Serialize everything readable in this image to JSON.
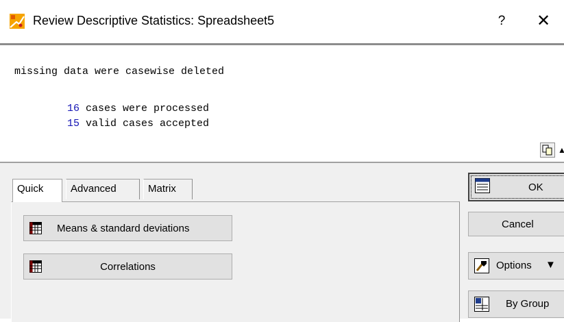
{
  "window": {
    "title": "Review Descriptive Statistics: Spreadsheet5",
    "help_glyph": "?",
    "close_glyph": "✕"
  },
  "results": {
    "line1": "missing data were casewise deleted",
    "processed_count": "16",
    "processed_text": " cases were processed",
    "valid_count": "15",
    "valid_text": " valid cases accepted"
  },
  "tabs": {
    "quick": "Quick",
    "advanced": "Advanced",
    "matrix": "Matrix"
  },
  "quick_panel": {
    "means_label": "Means & standard deviations",
    "correlations_label": "Correlations"
  },
  "side_buttons": {
    "ok": "OK",
    "cancel": "Cancel",
    "options": "Options",
    "bygroup": "By Group"
  },
  "icons": {
    "app": "statistica-app-icon",
    "copy": "copy-icon",
    "table": "table-grid-icon",
    "options": "options-icon",
    "bygroup": "by-group-icon"
  },
  "colors": {
    "count_text": "#1414b4",
    "dialog_bg": "#f0f0f0",
    "button_bg": "#e1e1e1"
  }
}
